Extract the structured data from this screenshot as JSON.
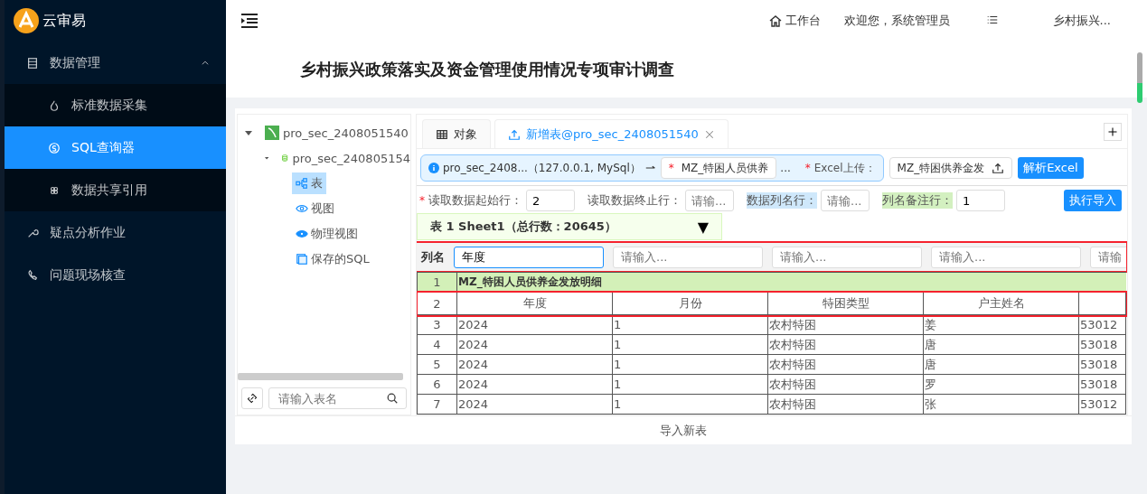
{
  "app": {
    "name": "云审易"
  },
  "sidebar": {
    "items": [
      {
        "label": "数据管理",
        "expanded": true,
        "children": [
          {
            "label": "标准数据采集",
            "selected": false
          },
          {
            "label": "SQL查询器",
            "selected": true
          },
          {
            "label": "数据共享引用",
            "selected": false
          }
        ]
      },
      {
        "label": "疑点分析作业"
      },
      {
        "label": "问题现场核查"
      }
    ]
  },
  "header": {
    "workbench": "工作台",
    "welcome": "欢迎您，系统管理员",
    "project": "乡村振兴..."
  },
  "page_title": "乡村振兴政策落实及资金管理使用情况专项审计调查",
  "tree": {
    "nodes": [
      {
        "label": "pro_sec_2408051540",
        "expanded": true,
        "children": [
          {
            "label": "pro_sec_240805154",
            "expanded": true,
            "children": [
              {
                "label": "表",
                "selected": true
              },
              {
                "label": "视图",
                "selected": false
              },
              {
                "label": "物理视图",
                "selected": false
              },
              {
                "label": "保存的SQL",
                "selected": false
              }
            ]
          }
        ]
      }
    ],
    "search": {
      "placeholder": "请输入表名"
    }
  },
  "tabs": [
    {
      "label": "对象",
      "selected": false,
      "closable": false
    },
    {
      "label": "新增表@pro_sec_2408051540",
      "selected": true,
      "closable": true
    }
  ],
  "import_form": {
    "source": "pro_sec_2408...（127.0.0.1, MySql）",
    "target": {
      "required_mark": "*",
      "value": "MZ_特困人员供养",
      "more": "..."
    },
    "excel": {
      "required_mark": "*",
      "label": "Excel上传：",
      "value": "MZ_特困供养金发"
    },
    "parse_button": "解析Excel",
    "row_fields": [
      {
        "required_mark": "*",
        "label": "读取数据起始行：",
        "value": "2"
      },
      {
        "label": "读取数据终止行：",
        "placeholder": "请输..."
      },
      {
        "label": "数据列名行：",
        "placeholder": "请输...",
        "color": "#cfe8fb"
      },
      {
        "label": "列名备注行：",
        "value": "1",
        "color": "#d3f0c0"
      }
    ],
    "import_button": "执行导入"
  },
  "sheet": {
    "label": "表 1 Sheet1（总行数：20645）",
    "caret": "▼"
  },
  "column_names": {
    "label": "列名",
    "highlighted": true,
    "inputs": [
      {
        "value": "年度",
        "focused": true
      },
      {
        "placeholder": "请输入...",
        "focused": false
      },
      {
        "placeholder": "请输入...",
        "focused": false
      },
      {
        "placeholder": "请输入...",
        "focused": false
      },
      {
        "placeholder": "请输",
        "focused": false
      }
    ]
  },
  "table": {
    "rows": [
      {
        "number": "1",
        "kind": "title",
        "highlighted": false,
        "cells": [
          "MZ_特困人员供养金发放明细",
          "",
          "",
          "",
          ""
        ]
      },
      {
        "number": "2",
        "kind": "header",
        "highlighted": true,
        "cells": [
          "年度",
          "月份",
          "特困类型",
          "户主姓名"
        ]
      },
      {
        "number": "3",
        "kind": "data",
        "highlighted": false,
        "cells": [
          "2024",
          "1",
          "农村特困",
          "姜",
          "53012"
        ]
      },
      {
        "number": "4",
        "kind": "data",
        "highlighted": false,
        "cells": [
          "2024",
          "1",
          "农村特困",
          "唐",
          "53018"
        ]
      },
      {
        "number": "5",
        "kind": "data",
        "highlighted": false,
        "cells": [
          "2024",
          "1",
          "农村特困",
          "唐",
          "53018"
        ]
      },
      {
        "number": "6",
        "kind": "data",
        "highlighted": false,
        "cells": [
          "2024",
          "1",
          "农村特困",
          "罗",
          "53018"
        ]
      },
      {
        "number": "7",
        "kind": "data",
        "highlighted": false,
        "cells": [
          "2024",
          "1",
          "农村特困",
          "张",
          "53012"
        ]
      }
    ]
  },
  "footer": {
    "label": "导入新表"
  }
}
